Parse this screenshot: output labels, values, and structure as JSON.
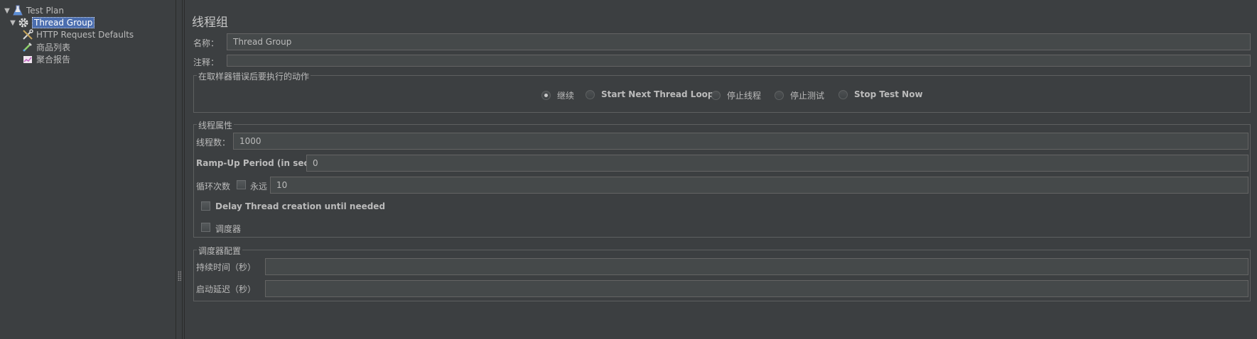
{
  "tree": {
    "items": [
      {
        "label": "Test Plan",
        "icon": "test-plan-icon"
      },
      {
        "label": "Thread Group",
        "icon": "gear-icon"
      },
      {
        "label": "HTTP Request Defaults",
        "icon": "wrench-icon"
      },
      {
        "label": "商品列表",
        "icon": "pipette-icon"
      },
      {
        "label": "聚合报告",
        "icon": "chart-icon"
      }
    ]
  },
  "main": {
    "title": "线程组",
    "name_label": "名称：",
    "name_value": "Thread Group",
    "comment_label": "注释：",
    "comment_value": "",
    "error_action": {
      "legend": "在取样器错误后要执行的动作",
      "options": [
        "继续",
        "Start Next Thread Loop",
        "停止线程",
        "停止测试",
        "Stop Test Now"
      ],
      "selected": "继续"
    },
    "thread_props": {
      "legend": "线程属性",
      "threads_label": "线程数：",
      "threads_value": "1000",
      "rampup_label": "Ramp-Up Period (in seconds):",
      "rampup_value": "0",
      "loop_label": "循环次数",
      "forever_label": "永远",
      "forever_checked": false,
      "loop_value": "10",
      "delay_label": "Delay Thread creation until needed",
      "delay_checked": false,
      "scheduler_label": "调度器",
      "scheduler_checked": false
    },
    "scheduler_config": {
      "legend": "调度器配置",
      "duration_label": "持续时间（秒）",
      "duration_value": "",
      "delay_label": "启动延迟（秒）",
      "delay_value": ""
    }
  },
  "colors": {
    "background": "#3c3f41",
    "field": "#45494a",
    "selection": "#4b6eaf",
    "text": "#bbbbbb"
  }
}
